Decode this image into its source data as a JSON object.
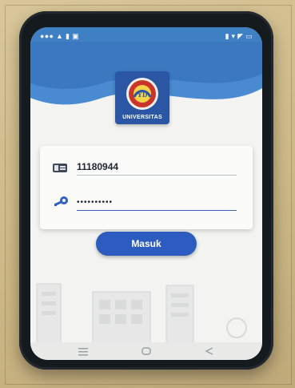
{
  "status_bar": {
    "left_text": "●●● ▲ ▮ ▣",
    "right_text": "▮ ▾ ◤ ▭"
  },
  "logo": {
    "text": "UNIVERSITAS"
  },
  "login": {
    "username_value": "11180944",
    "password_value": "••••••••••"
  },
  "button": {
    "label": "Masuk"
  },
  "colors": {
    "brand_blue": "#2d5cc0",
    "header_blue": "#3f7fc3"
  },
  "icons": {
    "id": "id-card-icon",
    "password": "key-icon",
    "nav_menu": "menu-icon",
    "nav_home": "home-icon",
    "nav_back": "back-icon"
  }
}
